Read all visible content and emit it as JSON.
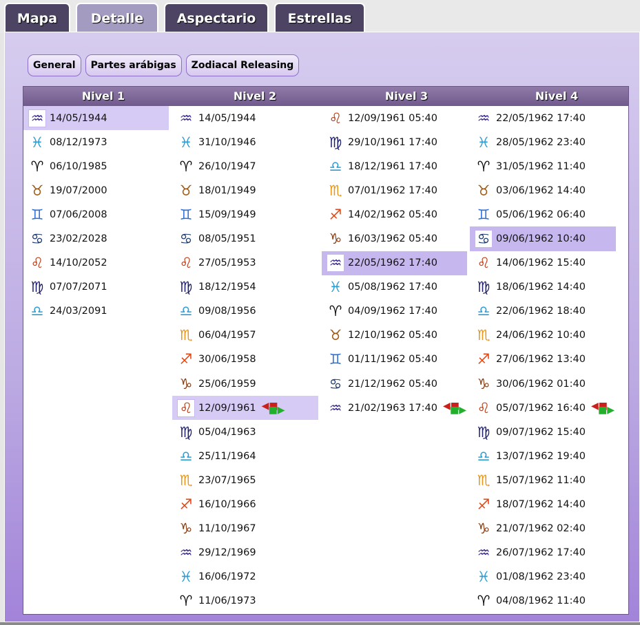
{
  "tabs": [
    {
      "label": "Mapa",
      "active": false
    },
    {
      "label": "Detalle",
      "active": true
    },
    {
      "label": "Aspectario",
      "active": false
    },
    {
      "label": "Estrellas",
      "active": false
    }
  ],
  "subtabs": [
    "General",
    "Partes arábigas",
    "Zodiacal Releasing"
  ],
  "columns": [
    "Nivel 1",
    "Nivel 2",
    "Nivel 3",
    "Nivel 4"
  ],
  "sign_icons": {
    "aquarius": "♒",
    "pisces": "♓",
    "aries": "♈",
    "taurus": "♉",
    "gemini": "♊",
    "cancer": "♋",
    "leo": "♌",
    "virgo": "♍",
    "libra": "♎",
    "scorpio": "♏",
    "sagittarius": "♐",
    "capricorn": "♑"
  },
  "levels": [
    [
      {
        "sign": "aquarius",
        "date": "14/05/1944",
        "selected": true
      },
      {
        "sign": "pisces",
        "date": "08/12/1973"
      },
      {
        "sign": "aries",
        "date": "06/10/1985"
      },
      {
        "sign": "taurus",
        "date": "19/07/2000"
      },
      {
        "sign": "gemini",
        "date": "07/06/2008"
      },
      {
        "sign": "cancer",
        "date": "23/02/2028"
      },
      {
        "sign": "leo",
        "date": "14/10/2052"
      },
      {
        "sign": "virgo",
        "date": "07/07/2071"
      },
      {
        "sign": "libra",
        "date": "24/03/2091"
      }
    ],
    [
      {
        "sign": "aquarius",
        "date": "14/05/1944"
      },
      {
        "sign": "pisces",
        "date": "31/10/1946"
      },
      {
        "sign": "aries",
        "date": "26/10/1947"
      },
      {
        "sign": "taurus",
        "date": "18/01/1949"
      },
      {
        "sign": "gemini",
        "date": "15/09/1949"
      },
      {
        "sign": "cancer",
        "date": "08/05/1951"
      },
      {
        "sign": "leo",
        "date": "27/05/1953"
      },
      {
        "sign": "virgo",
        "date": "18/12/1954"
      },
      {
        "sign": "libra",
        "date": "09/08/1956"
      },
      {
        "sign": "scorpio",
        "date": "06/04/1957"
      },
      {
        "sign": "sagittarius",
        "date": "30/06/1958"
      },
      {
        "sign": "capricorn",
        "date": "25/06/1959"
      },
      {
        "sign": "leo",
        "date": "12/09/1961",
        "selected": true,
        "loosing_bond": true
      },
      {
        "sign": "virgo",
        "date": "05/04/1963"
      },
      {
        "sign": "libra",
        "date": "25/11/1964"
      },
      {
        "sign": "scorpio",
        "date": "23/07/1965"
      },
      {
        "sign": "sagittarius",
        "date": "16/10/1966"
      },
      {
        "sign": "capricorn",
        "date": "11/10/1967"
      },
      {
        "sign": "aquarius",
        "date": "29/12/1969"
      },
      {
        "sign": "pisces",
        "date": "16/06/1972"
      },
      {
        "sign": "aries",
        "date": "11/06/1973"
      }
    ],
    [
      {
        "sign": "leo",
        "date": "12/09/1961 05:40"
      },
      {
        "sign": "virgo",
        "date": "29/10/1961 17:40"
      },
      {
        "sign": "libra",
        "date": "18/12/1961 17:40"
      },
      {
        "sign": "scorpio",
        "date": "07/01/1962 17:40"
      },
      {
        "sign": "sagittarius",
        "date": "14/02/1962 05:40"
      },
      {
        "sign": "capricorn",
        "date": "16/03/1962 05:40"
      },
      {
        "sign": "aquarius",
        "date": "22/05/1962 17:40",
        "selected": true
      },
      {
        "sign": "pisces",
        "date": "05/08/1962 17:40"
      },
      {
        "sign": "aries",
        "date": "04/09/1962 17:40"
      },
      {
        "sign": "taurus",
        "date": "12/10/1962 05:40"
      },
      {
        "sign": "gemini",
        "date": "01/11/1962 05:40"
      },
      {
        "sign": "cancer",
        "date": "21/12/1962 05:40"
      },
      {
        "sign": "aquarius",
        "date": "21/02/1963 17:40",
        "loosing_bond": true
      }
    ],
    [
      {
        "sign": "aquarius",
        "date": "22/05/1962 17:40"
      },
      {
        "sign": "pisces",
        "date": "28/05/1962 23:40"
      },
      {
        "sign": "aries",
        "date": "31/05/1962 11:40"
      },
      {
        "sign": "taurus",
        "date": "03/06/1962 14:40"
      },
      {
        "sign": "gemini",
        "date": "05/06/1962 06:40"
      },
      {
        "sign": "cancer",
        "date": "09/06/1962 10:40",
        "selected": true
      },
      {
        "sign": "leo",
        "date": "14/06/1962 15:40"
      },
      {
        "sign": "virgo",
        "date": "18/06/1962 14:40"
      },
      {
        "sign": "libra",
        "date": "22/06/1962 18:40"
      },
      {
        "sign": "scorpio",
        "date": "24/06/1962 10:40"
      },
      {
        "sign": "sagittarius",
        "date": "27/06/1962 13:40"
      },
      {
        "sign": "capricorn",
        "date": "30/06/1962 01:40"
      },
      {
        "sign": "leo",
        "date": "05/07/1962 16:40",
        "loosing_bond": true
      },
      {
        "sign": "virgo",
        "date": "09/07/1962 15:40"
      },
      {
        "sign": "libra",
        "date": "13/07/1962 19:40"
      },
      {
        "sign": "scorpio",
        "date": "15/07/1962 11:40"
      },
      {
        "sign": "sagittarius",
        "date": "18/07/1962 14:40"
      },
      {
        "sign": "capricorn",
        "date": "21/07/1962 02:40"
      },
      {
        "sign": "aquarius",
        "date": "26/07/1962 17:40"
      },
      {
        "sign": "pisces",
        "date": "01/08/1962 23:40"
      },
      {
        "sign": "aries",
        "date": "04/08/1962 11:40"
      }
    ]
  ]
}
